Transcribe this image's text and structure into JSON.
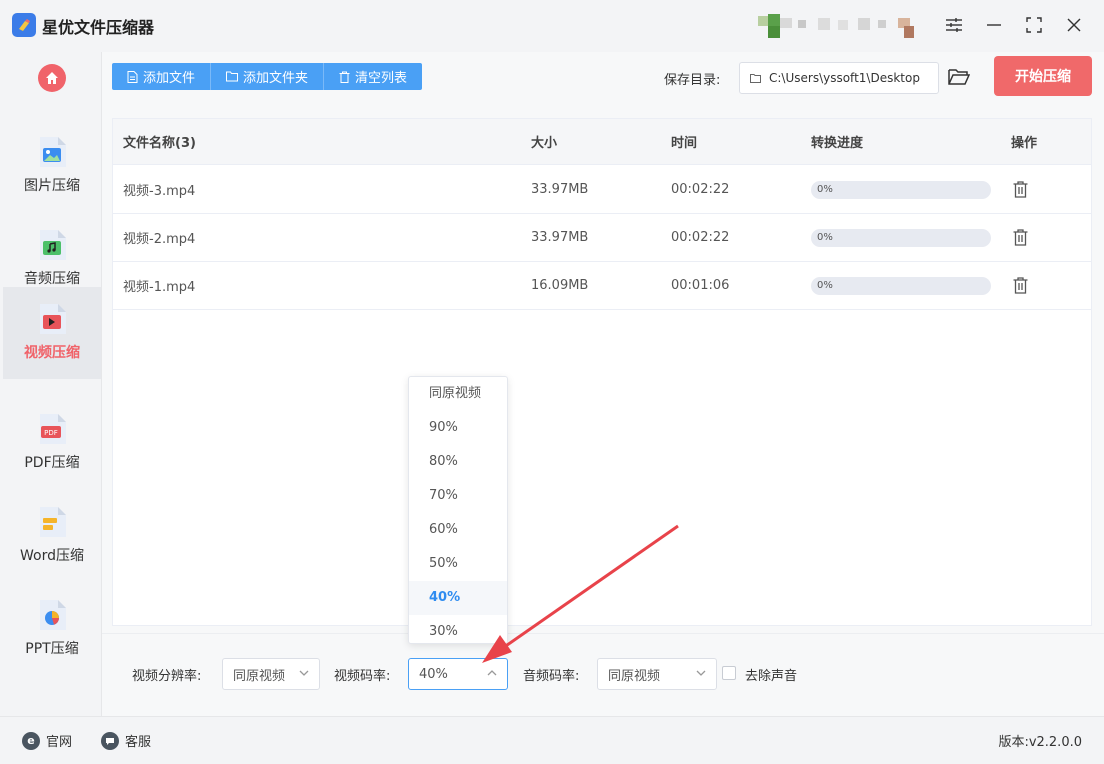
{
  "app": {
    "title": "星优文件压缩器"
  },
  "sidebar": {
    "items": [
      {
        "label": "图片压缩",
        "icon": "image-file-icon"
      },
      {
        "label": "音频压缩",
        "icon": "audio-file-icon"
      },
      {
        "label": "视频压缩",
        "icon": "video-file-icon",
        "active": true
      },
      {
        "label": "PDF压缩",
        "icon": "pdf-file-icon"
      },
      {
        "label": "Word压缩",
        "icon": "word-file-icon"
      },
      {
        "label": "PPT压缩",
        "icon": "ppt-file-icon"
      }
    ]
  },
  "toolbar": {
    "add_file": "添加文件",
    "add_folder": "添加文件夹",
    "clear_list": "清空列表",
    "save_dir_label": "保存目录:",
    "save_dir_value": "C:\\Users\\yssoft1\\Desktop",
    "start_button": "开始压缩"
  },
  "table": {
    "headers": {
      "name": "文件名称(3)",
      "size": "大小",
      "time": "时间",
      "progress": "转换进度",
      "action": "操作"
    },
    "rows": [
      {
        "name": "视频-3.mp4",
        "size": "33.97MB",
        "time": "00:02:22",
        "progress": "0%"
      },
      {
        "name": "视频-2.mp4",
        "size": "33.97MB",
        "time": "00:02:22",
        "progress": "0%"
      },
      {
        "name": "视频-1.mp4",
        "size": "16.09MB",
        "time": "00:01:06",
        "progress": "0%"
      }
    ]
  },
  "dropdown": {
    "options": [
      "同原视频",
      "90%",
      "80%",
      "70%",
      "60%",
      "50%",
      "40%",
      "30%"
    ],
    "selected": "40%"
  },
  "settings": {
    "resolution_label": "视频分辨率:",
    "resolution_value": "同原视频",
    "bitrate_label": "视频码率:",
    "bitrate_value": "40%",
    "audio_label": "音频码率:",
    "audio_value": "同原视频",
    "mute_label": "去除声音"
  },
  "footer": {
    "website": "官网",
    "support": "客服",
    "version": "版本:v2.2.0.0"
  },
  "colors": {
    "accent_blue": "#4aa0f5",
    "accent_red": "#f0696a",
    "selected_blue": "#2f8cf0"
  }
}
